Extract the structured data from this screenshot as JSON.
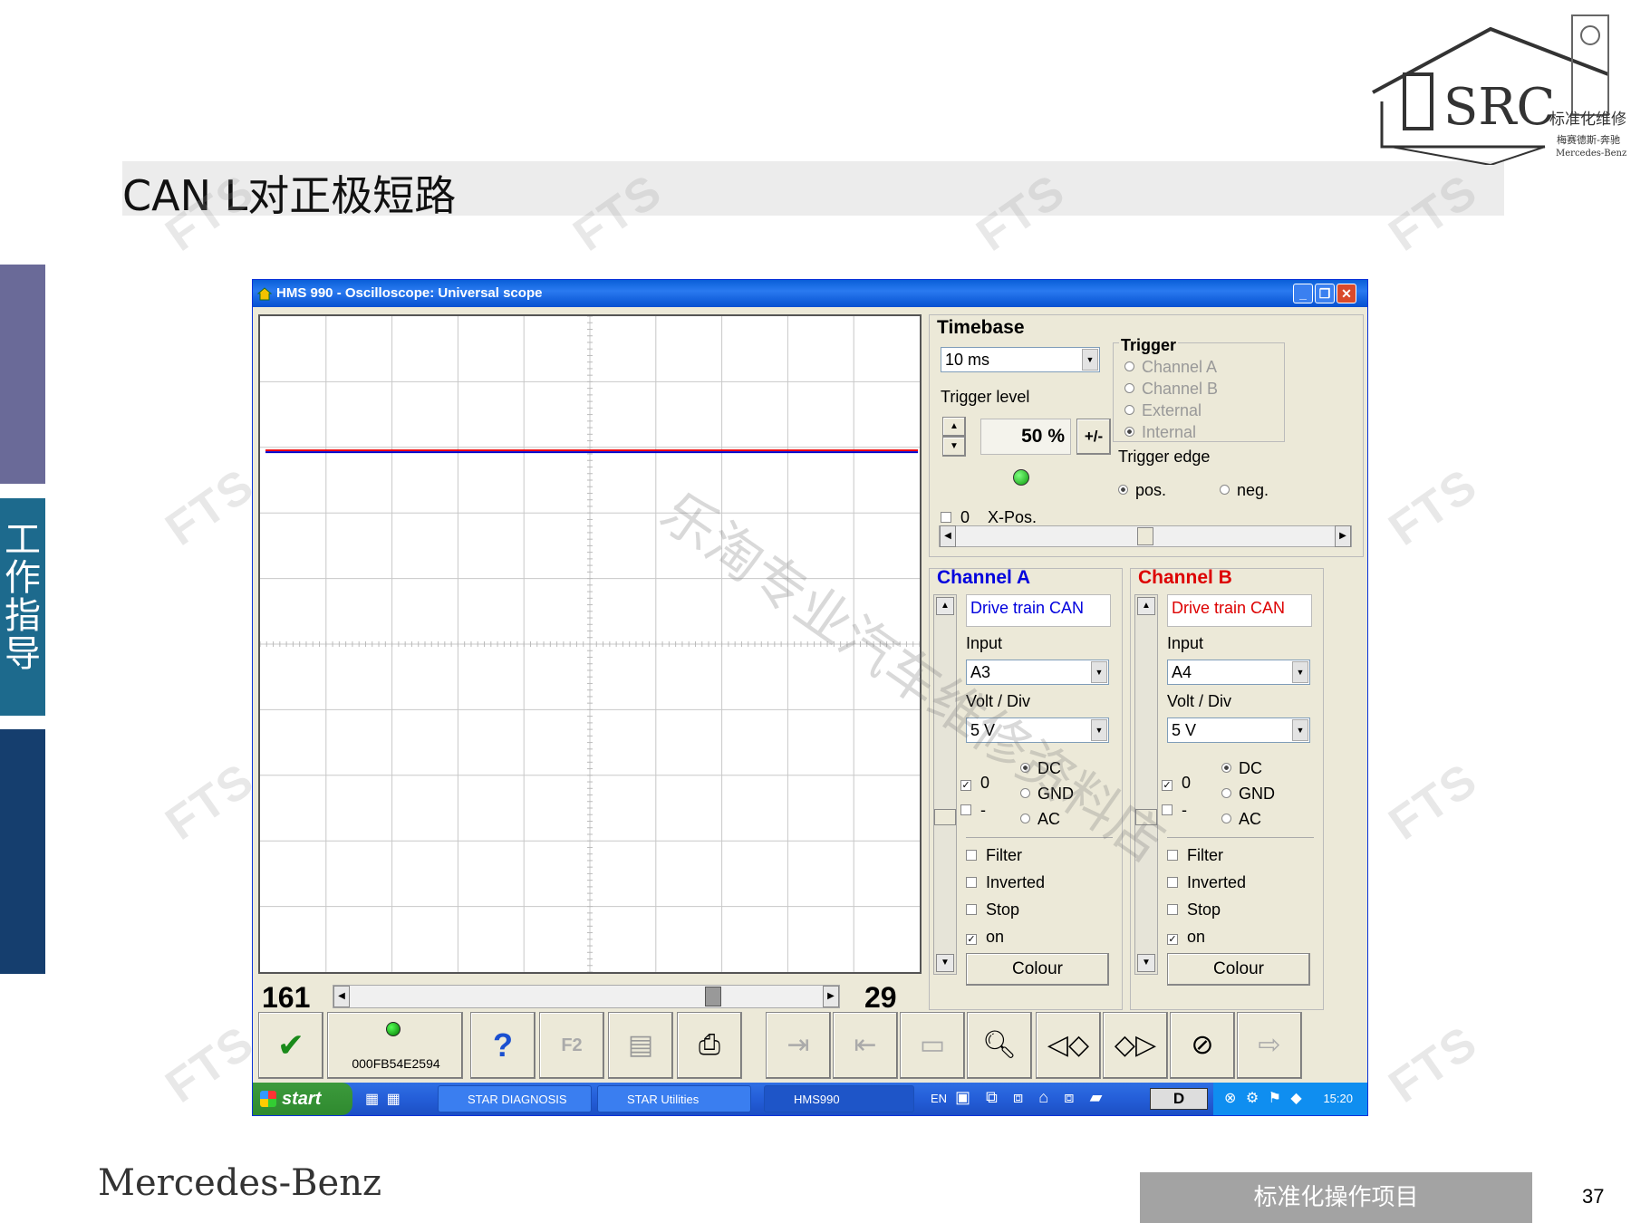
{
  "slide": {
    "title": "CAN L对正极短路",
    "side_text": "工作指导",
    "brand": "Mercedes-Benz",
    "footer": "标准化操作项目",
    "page_number": "37",
    "logo_text": "SRC",
    "logo_sub": "标准化维修",
    "logo_sub2": "梅赛德斯-奔驰",
    "logo_sub3": "Mercedes-Benz",
    "watermark": "FTS",
    "watermark_cn": "乐淘专业汽车维修资料店"
  },
  "window": {
    "title": "HMS 990 - Oscilloscope: Universal scope"
  },
  "scope": {
    "scroll_left_value": "161",
    "scroll_right_value": "29",
    "trace_colors": {
      "channel_a": "#0000cc",
      "channel_b": "#ee0000"
    },
    "scroll_position": 0.78
  },
  "timebase": {
    "label": "Timebase",
    "value": "10 ms",
    "trigger_level_label": "Trigger level",
    "trigger_level_value": "50 %",
    "plus_minus": "+/-",
    "zero_label": "0",
    "xpos_label": "X-Pos."
  },
  "trigger": {
    "label": "Trigger",
    "options": [
      "Channel A",
      "Channel B",
      "External",
      "Internal"
    ],
    "edge_label": "Trigger edge",
    "edge_pos": "pos.",
    "edge_neg": "neg."
  },
  "channel_a": {
    "label": "Channel A",
    "color": "#0000dd",
    "name": "Drive train CAN",
    "input_label": "Input",
    "input": "A3",
    "volt_label": "Volt / Div",
    "volt": "5 V",
    "zero": "0",
    "minus": "-",
    "coupling": [
      "DC",
      "GND",
      "AC"
    ],
    "filter": "Filter",
    "inverted": "Inverted",
    "stop": "Stop",
    "on": "on",
    "colour": "Colour"
  },
  "channel_b": {
    "label": "Channel B",
    "color": "#dd0000",
    "name": "Drive train CAN",
    "input_label": "Input",
    "input": "A4",
    "volt_label": "Volt / Div",
    "volt": "5 V",
    "zero": "0",
    "minus": "-",
    "coupling": [
      "DC",
      "GND",
      "AC"
    ],
    "filter": "Filter",
    "inverted": "Inverted",
    "stop": "Stop",
    "on": "on",
    "colour": "Colour"
  },
  "toolbar": {
    "device_id": "000FB54E2594",
    "help": "?",
    "f2": "F2"
  },
  "taskbar": {
    "start": "start",
    "tasks": [
      "STAR DIAGNOSIS",
      "STAR Utilities",
      "HMS990"
    ],
    "lang": "EN",
    "drive": "D",
    "clock": "15:20"
  }
}
